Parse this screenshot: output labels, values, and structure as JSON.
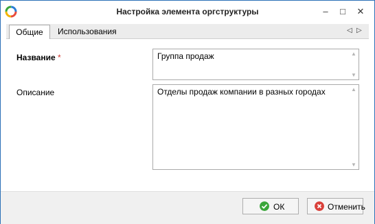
{
  "window": {
    "title": "Настройка элемента оргструктуры",
    "controls": {
      "minimize": "–",
      "maximize": "□",
      "close": "✕"
    }
  },
  "tabs": [
    {
      "label": "Общие",
      "active": true
    },
    {
      "label": "Использования",
      "active": false
    }
  ],
  "tab_nav": {
    "prev": "◁",
    "next": "▷"
  },
  "form": {
    "name_label": "Название",
    "required_marker": "*",
    "name_value": "Группа продаж",
    "description_label": "Описание",
    "description_value": "Отделы продаж компании в разных городах"
  },
  "footer": {
    "ok_label": "ОК",
    "cancel_label": "Отменить"
  },
  "colors": {
    "accent": "#2a6fb6",
    "ok_icon": "#3aa63a",
    "cancel_icon": "#d9403a"
  }
}
